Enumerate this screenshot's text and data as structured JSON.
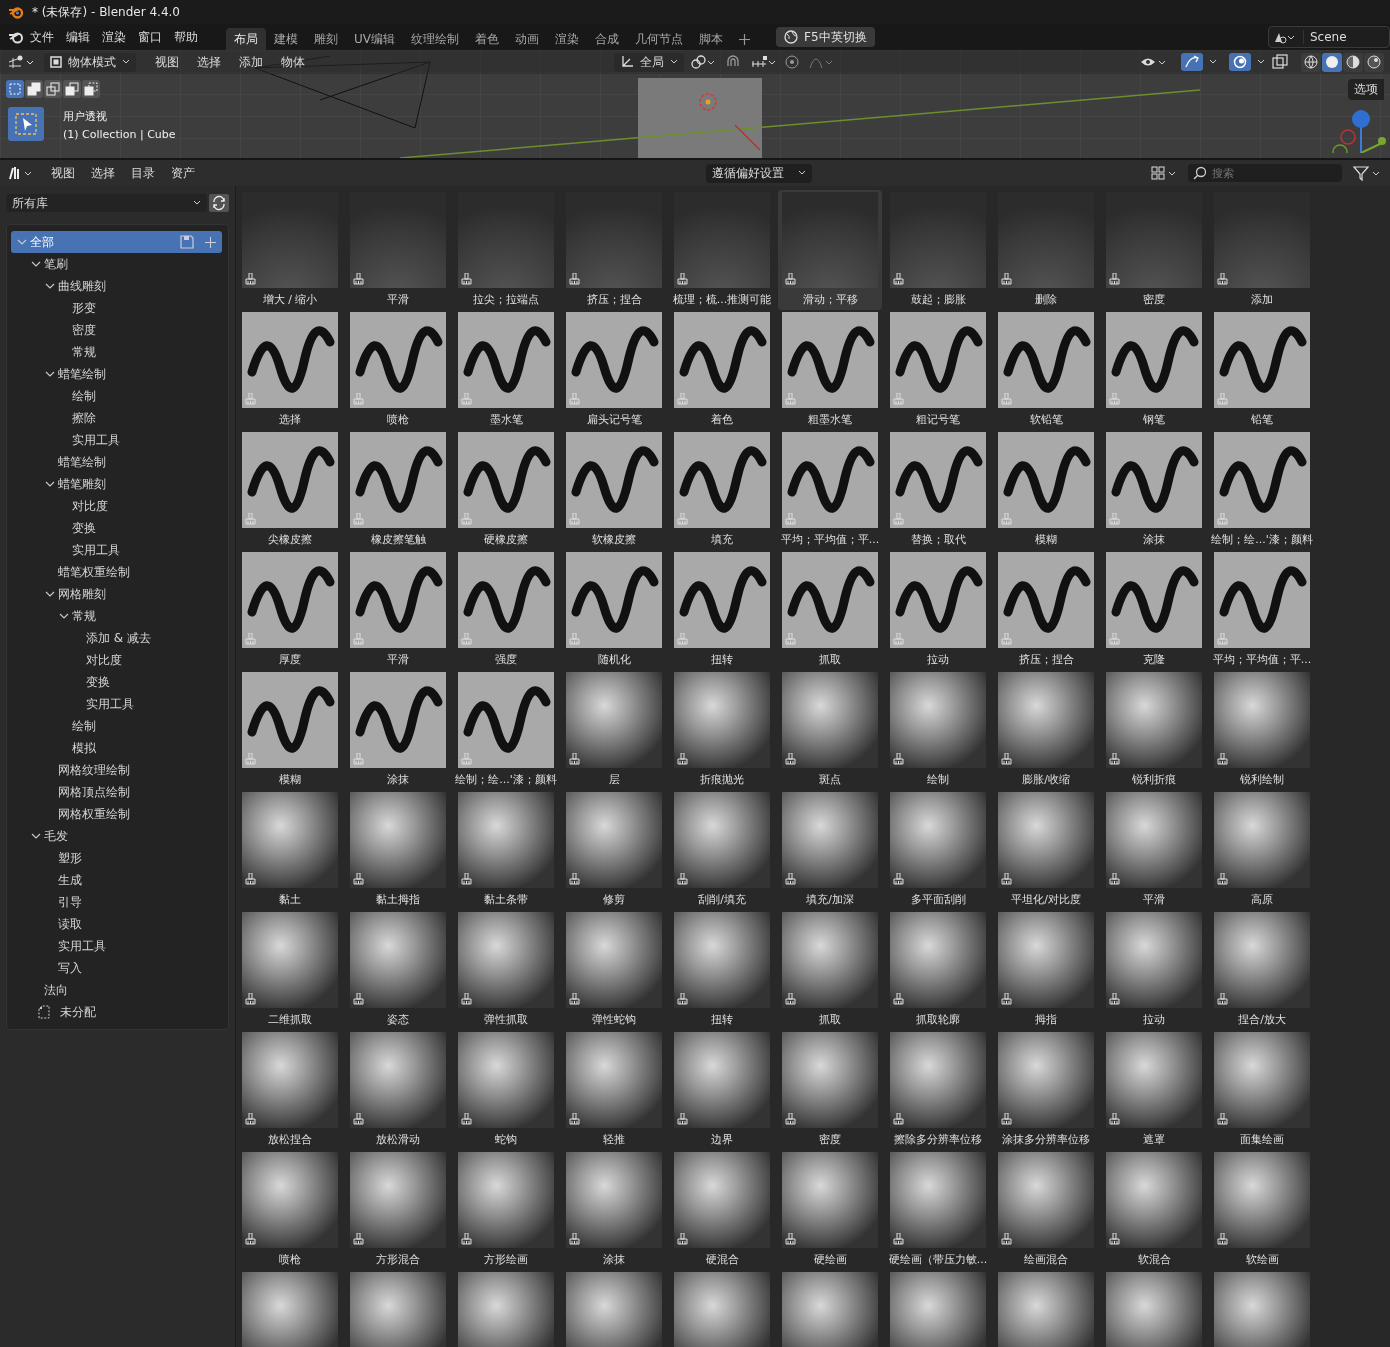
{
  "window": {
    "title": "* (未保存) - Blender 4.4.0"
  },
  "menu_bar": {
    "menus": [
      "文件",
      "编辑",
      "渲染",
      "窗口",
      "帮助"
    ],
    "workspace_tabs": [
      {
        "label": "布局",
        "selected": true
      },
      {
        "label": "建模",
        "selected": false
      },
      {
        "label": "雕刻",
        "selected": false
      },
      {
        "label": "UV编辑",
        "selected": false
      },
      {
        "label": "纹理绘制",
        "selected": false
      },
      {
        "label": "着色",
        "selected": false
      },
      {
        "label": "动画",
        "selected": false
      },
      {
        "label": "渲染",
        "selected": false
      },
      {
        "label": "合成",
        "selected": false
      },
      {
        "label": "几何节点",
        "selected": false
      },
      {
        "label": "脚本",
        "selected": false
      }
    ],
    "language_button": "F5中英切换",
    "scene": "Scene"
  },
  "viewport": {
    "mode": "物体模式",
    "menus": [
      "视图",
      "选择",
      "添加",
      "物体"
    ],
    "orientation": "全局",
    "select_modes": [
      {
        "kind": "set",
        "selected": true
      },
      {
        "kind": "extend",
        "selected": false
      },
      {
        "kind": "subtract",
        "selected": false
      },
      {
        "kind": "difference",
        "selected": false
      },
      {
        "kind": "intersect",
        "selected": false
      }
    ],
    "shading": [
      {
        "kind": "wireframe",
        "selected": false
      },
      {
        "kind": "solid",
        "selected": true
      },
      {
        "kind": "material",
        "selected": false
      },
      {
        "kind": "rendered",
        "selected": false
      }
    ],
    "view_name": "用户透视",
    "object_info": "(1) Collection | Cube",
    "sidebar_tab": "选项"
  },
  "asset_browser": {
    "menus": [
      "视图",
      "选择",
      "目录",
      "资产"
    ],
    "import_method": "遵循偏好设置",
    "search": {
      "placeholder": "搜索"
    },
    "library": "所有库",
    "tree": [
      {
        "label": "全部",
        "selected": true,
        "expanded": true,
        "children": [
          {
            "label": "笔刷",
            "selected": false,
            "expanded": true,
            "children": [
              {
                "label": "曲线雕刻",
                "selected": false,
                "expanded": true,
                "children": [
                  {
                    "label": "形变",
                    "selected": false
                  },
                  {
                    "label": "密度",
                    "selected": false
                  },
                  {
                    "label": "常规",
                    "selected": false
                  }
                ]
              },
              {
                "label": "蜡笔绘制",
                "selected": false,
                "expanded": true,
                "children": [
                  {
                    "label": "绘制",
                    "selected": false
                  },
                  {
                    "label": "擦除",
                    "selected": false
                  },
                  {
                    "label": "实用工具",
                    "selected": false
                  }
                ]
              },
              {
                "label": "蜡笔绘制",
                "selected": false
              },
              {
                "label": "蜡笔雕刻",
                "selected": false,
                "expanded": true,
                "children": [
                  {
                    "label": "对比度",
                    "selected": false
                  },
                  {
                    "label": "变换",
                    "selected": false
                  },
                  {
                    "label": "实用工具",
                    "selected": false
                  }
                ]
              },
              {
                "label": "蜡笔权重绘制",
                "selected": false
              },
              {
                "label": "网格雕刻",
                "selected": false,
                "expanded": true,
                "children": [
                  {
                    "label": "常规",
                    "selected": false,
                    "expanded": true,
                    "children": [
                      {
                        "label": "添加 & 减去",
                        "selected": false
                      },
                      {
                        "label": "对比度",
                        "selected": false
                      },
                      {
                        "label": "变换",
                        "selected": false
                      },
                      {
                        "label": "实用工具",
                        "selected": false
                      }
                    ]
                  },
                  {
                    "label": "绘制",
                    "selected": false
                  },
                  {
                    "label": "模拟",
                    "selected": false
                  }
                ]
              },
              {
                "label": "网格纹理绘制",
                "selected": false
              },
              {
                "label": "网格顶点绘制",
                "selected": false
              },
              {
                "label": "网格权重绘制",
                "selected": false
              }
            ]
          },
          {
            "label": "毛发",
            "selected": false,
            "expanded": true,
            "children": [
              {
                "label": "塑形",
                "selected": false
              },
              {
                "label": "生成",
                "selected": false
              },
              {
                "label": "引导",
                "selected": false
              },
              {
                "label": "读取",
                "selected": false
              },
              {
                "label": "实用工具",
                "selected": false
              },
              {
                "label": "写入",
                "selected": false
              }
            ]
          },
          {
            "label": "法向",
            "selected": false
          }
        ]
      }
    ],
    "unassigned": {
      "label": "未分配",
      "selected": false
    },
    "assets": [
      {
        "label": "增大 / 缩小",
        "kind": "hair",
        "selected": false
      },
      {
        "label": "平滑",
        "kind": "hair",
        "selected": false
      },
      {
        "label": "拉尖；拉端点",
        "kind": "hair",
        "selected": false
      },
      {
        "label": "挤压；捏合",
        "kind": "hair",
        "selected": false
      },
      {
        "label": "梳理；梳...推测可能",
        "kind": "hair",
        "selected": false
      },
      {
        "label": "滑动；平移",
        "kind": "hair",
        "selected": true
      },
      {
        "label": "鼓起；膨胀",
        "kind": "hair",
        "selected": false
      },
      {
        "label": "删除",
        "kind": "hair",
        "selected": false
      },
      {
        "label": "密度",
        "kind": "hair",
        "selected": false
      },
      {
        "label": "添加",
        "kind": "hair",
        "selected": false
      },
      {
        "label": "选择",
        "kind": "stroke",
        "selected": false
      },
      {
        "label": "喷枪",
        "kind": "stroke",
        "selected": false
      },
      {
        "label": "墨水笔",
        "kind": "stroke",
        "selected": false
      },
      {
        "label": "扁头记号笔",
        "kind": "stroke",
        "selected": false
      },
      {
        "label": "着色",
        "kind": "stroke",
        "selected": false
      },
      {
        "label": "粗墨水笔",
        "kind": "stroke",
        "selected": false
      },
      {
        "label": "粗记号笔",
        "kind": "stroke",
        "selected": false
      },
      {
        "label": "软铅笔",
        "kind": "stroke",
        "selected": false
      },
      {
        "label": "钢笔",
        "kind": "stroke",
        "selected": false
      },
      {
        "label": "铅笔",
        "kind": "stroke",
        "selected": false
      },
      {
        "label": "尖橡皮擦",
        "kind": "stroke",
        "selected": false
      },
      {
        "label": "橡皮擦笔触",
        "kind": "stroke",
        "selected": false
      },
      {
        "label": "硬橡皮擦",
        "kind": "stroke",
        "selected": false
      },
      {
        "label": "软橡皮擦",
        "kind": "stroke",
        "selected": false
      },
      {
        "label": "填充",
        "kind": "stroke",
        "selected": false
      },
      {
        "label": "平均；平均值；平...",
        "kind": "stroke",
        "selected": false
      },
      {
        "label": "替换；取代",
        "kind": "stroke",
        "selected": false
      },
      {
        "label": "模糊",
        "kind": "stroke",
        "selected": false
      },
      {
        "label": "涂抹",
        "kind": "stroke",
        "selected": false
      },
      {
        "label": "绘制；绘...'漆；颜料",
        "kind": "stroke",
        "selected": false
      },
      {
        "label": "厚度",
        "kind": "stroke",
        "selected": false
      },
      {
        "label": "平滑",
        "kind": "stroke",
        "selected": false
      },
      {
        "label": "强度",
        "kind": "stroke",
        "selected": false
      },
      {
        "label": "随机化",
        "kind": "stroke",
        "selected": false
      },
      {
        "label": "扭转",
        "kind": "stroke",
        "selected": false
      },
      {
        "label": "抓取",
        "kind": "stroke",
        "selected": false
      },
      {
        "label": "拉动",
        "kind": "stroke",
        "selected": false
      },
      {
        "label": "挤压；捏合",
        "kind": "stroke",
        "selected": false
      },
      {
        "label": "克隆",
        "kind": "stroke",
        "selected": false
      },
      {
        "label": "平均；平均值；平...",
        "kind": "stroke",
        "selected": false
      },
      {
        "label": "模糊",
        "kind": "stroke",
        "selected": false
      },
      {
        "label": "涂抹",
        "kind": "stroke",
        "selected": false
      },
      {
        "label": "绘制；绘...'漆；颜料",
        "kind": "stroke",
        "selected": false
      },
      {
        "label": "层",
        "kind": "sculpt",
        "selected": false
      },
      {
        "label": "折痕抛光",
        "kind": "sculpt",
        "selected": false
      },
      {
        "label": "斑点",
        "kind": "sculpt",
        "selected": false
      },
      {
        "label": "绘制",
        "kind": "sculpt",
        "selected": false
      },
      {
        "label": "膨胀/收缩",
        "kind": "sculpt",
        "selected": false
      },
      {
        "label": "锐利折痕",
        "kind": "sculpt",
        "selected": false
      },
      {
        "label": "锐利绘制",
        "kind": "sculpt",
        "selected": false
      },
      {
        "label": "黏土",
        "kind": "sculpt",
        "selected": false
      },
      {
        "label": "黏土拇指",
        "kind": "sculpt",
        "selected": false
      },
      {
        "label": "黏土条带",
        "kind": "sculpt",
        "selected": false
      },
      {
        "label": "修剪",
        "kind": "sculpt",
        "selected": false
      },
      {
        "label": "刮削/填充",
        "kind": "sculpt",
        "selected": false
      },
      {
        "label": "填充/加深",
        "kind": "sculpt",
        "selected": false
      },
      {
        "label": "多平面刮削",
        "kind": "sculpt",
        "selected": false
      },
      {
        "label": "平坦化/对比度",
        "kind": "sculpt",
        "selected": false
      },
      {
        "label": "平滑",
        "kind": "sculpt",
        "selected": false
      },
      {
        "label": "高原",
        "kind": "sculpt",
        "selected": false
      },
      {
        "label": "二维抓取",
        "kind": "sculpt",
        "selected": false
      },
      {
        "label": "姿态",
        "kind": "sculpt",
        "selected": false
      },
      {
        "label": "弹性抓取",
        "kind": "sculpt",
        "selected": false
      },
      {
        "label": "弹性蛇钩",
        "kind": "sculpt",
        "selected": false
      },
      {
        "label": "扭转",
        "kind": "sculpt",
        "selected": false
      },
      {
        "label": "抓取",
        "kind": "sculpt",
        "selected": false
      },
      {
        "label": "抓取轮廓",
        "kind": "sculpt",
        "selected": false
      },
      {
        "label": "拇指",
        "kind": "sculpt",
        "selected": false
      },
      {
        "label": "拉动",
        "kind": "sculpt",
        "selected": false
      },
      {
        "label": "捏合/放大",
        "kind": "sculpt",
        "selected": false
      },
      {
        "label": "放松捏合",
        "kind": "sculpt",
        "selected": false
      },
      {
        "label": "放松滑动",
        "kind": "sculpt",
        "selected": false
      },
      {
        "label": "蛇钩",
        "kind": "sculpt",
        "selected": false
      },
      {
        "label": "轻推",
        "kind": "sculpt",
        "selected": false
      },
      {
        "label": "边界",
        "kind": "sculpt",
        "selected": false
      },
      {
        "label": "密度",
        "kind": "sculpt",
        "selected": false
      },
      {
        "label": "擦除多分辨率位移",
        "kind": "sculpt",
        "selected": false
      },
      {
        "label": "涂抹多分辨率位移",
        "kind": "sculpt",
        "selected": false
      },
      {
        "label": "遮罩",
        "kind": "sculpt",
        "selected": false
      },
      {
        "label": "面集绘画",
        "kind": "sculpt",
        "selected": false
      },
      {
        "label": "喷枪",
        "kind": "sculpt",
        "selected": false
      },
      {
        "label": "方形混合",
        "kind": "sculpt",
        "selected": false
      },
      {
        "label": "方形绘画",
        "kind": "sculpt",
        "selected": false
      },
      {
        "label": "涂抹",
        "kind": "sculpt",
        "selected": false
      },
      {
        "label": "硬混合",
        "kind": "sculpt",
        "selected": false
      },
      {
        "label": "硬绘画",
        "kind": "sculpt",
        "selected": false
      },
      {
        "label": "硬绘画（带压力敏...",
        "kind": "sculpt",
        "selected": false
      },
      {
        "label": "绘画混合",
        "kind": "sculpt",
        "selected": false
      },
      {
        "label": "软混合",
        "kind": "sculpt",
        "selected": false
      },
      {
        "label": "软绘画",
        "kind": "sculpt",
        "selected": false
      },
      {
        "kind": "sculpt",
        "selected": false
      },
      {
        "kind": "sculpt",
        "selected": false
      },
      {
        "kind": "sculpt",
        "selected": false
      },
      {
        "kind": "sculpt",
        "selected": false
      },
      {
        "kind": "sculpt",
        "selected": false
      },
      {
        "kind": "sculpt",
        "selected": false
      },
      {
        "kind": "sculpt",
        "selected": false
      },
      {
        "kind": "sculpt",
        "selected": false
      },
      {
        "kind": "sculpt",
        "selected": false
      },
      {
        "kind": "sculpt",
        "selected": false
      }
    ]
  }
}
